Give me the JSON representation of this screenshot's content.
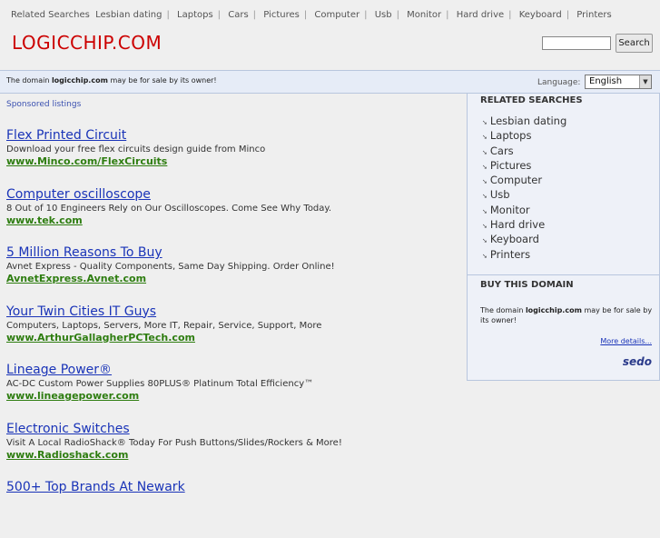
{
  "topbar": {
    "label": "Related Searches",
    "links": [
      "Lesbian dating",
      "Laptops",
      "Cars",
      "Pictures",
      "Computer",
      "Usb",
      "Monitor",
      "Hard drive",
      "Keyboard",
      "Printers"
    ]
  },
  "header": {
    "logo": "LOGICCHIP.COM",
    "search_button": "Search",
    "search_value": ""
  },
  "domainbar": {
    "notice_prefix": "The domain ",
    "notice_domain": "logicchip.com",
    "notice_suffix": " may be for sale by its owner!",
    "language_label": "Language:",
    "language_selected": "English"
  },
  "main": {
    "sponsored_label": "Sponsored listings",
    "ads": [
      {
        "title": "Flex Printed Circuit",
        "desc": "Download your free flex circuits design guide from Minco",
        "url": "www.Minco.com/FlexCircuits"
      },
      {
        "title": "Computer oscilloscope",
        "desc": "8 Out of 10 Engineers Rely on Our Oscilloscopes. Come See Why Today.",
        "url": "www.tek.com"
      },
      {
        "title": "5 Million Reasons To Buy",
        "desc": "Avnet Express - Quality Components, Same Day Shipping. Order Online!",
        "url": "AvnetExpress.Avnet.com"
      },
      {
        "title": "Your Twin Cities IT Guys",
        "desc": "Computers, Laptops, Servers, More IT, Repair, Service, Support, More",
        "url": "www.ArthurGallagherPCTech.com"
      },
      {
        "title": "Lineage Power®",
        "desc": "AC-DC Custom Power Supplies 80PLUS® Platinum Total Efficiency™",
        "url": "www.lineagepower.com"
      },
      {
        "title": "Electronic Switches",
        "desc": "Visit A Local RadioShack® Today For Push Buttons/Slides/Rockers & More!",
        "url": "www.Radioshack.com"
      },
      {
        "title": "500+ Top Brands At Newark",
        "desc": "",
        "url": ""
      }
    ]
  },
  "sidebar": {
    "related_heading": "RELATED SEARCHES",
    "related_items": [
      "Lesbian dating",
      "Laptops",
      "Cars",
      "Pictures",
      "Computer",
      "Usb",
      "Monitor",
      "Hard drive",
      "Keyboard",
      "Printers"
    ],
    "buy_heading": "BUY THIS DOMAIN",
    "buy_prefix": "The domain ",
    "buy_domain": "logicchip.com",
    "buy_suffix": " may be for sale by its owner!",
    "more_details": "More details...",
    "brand": "sedo"
  }
}
